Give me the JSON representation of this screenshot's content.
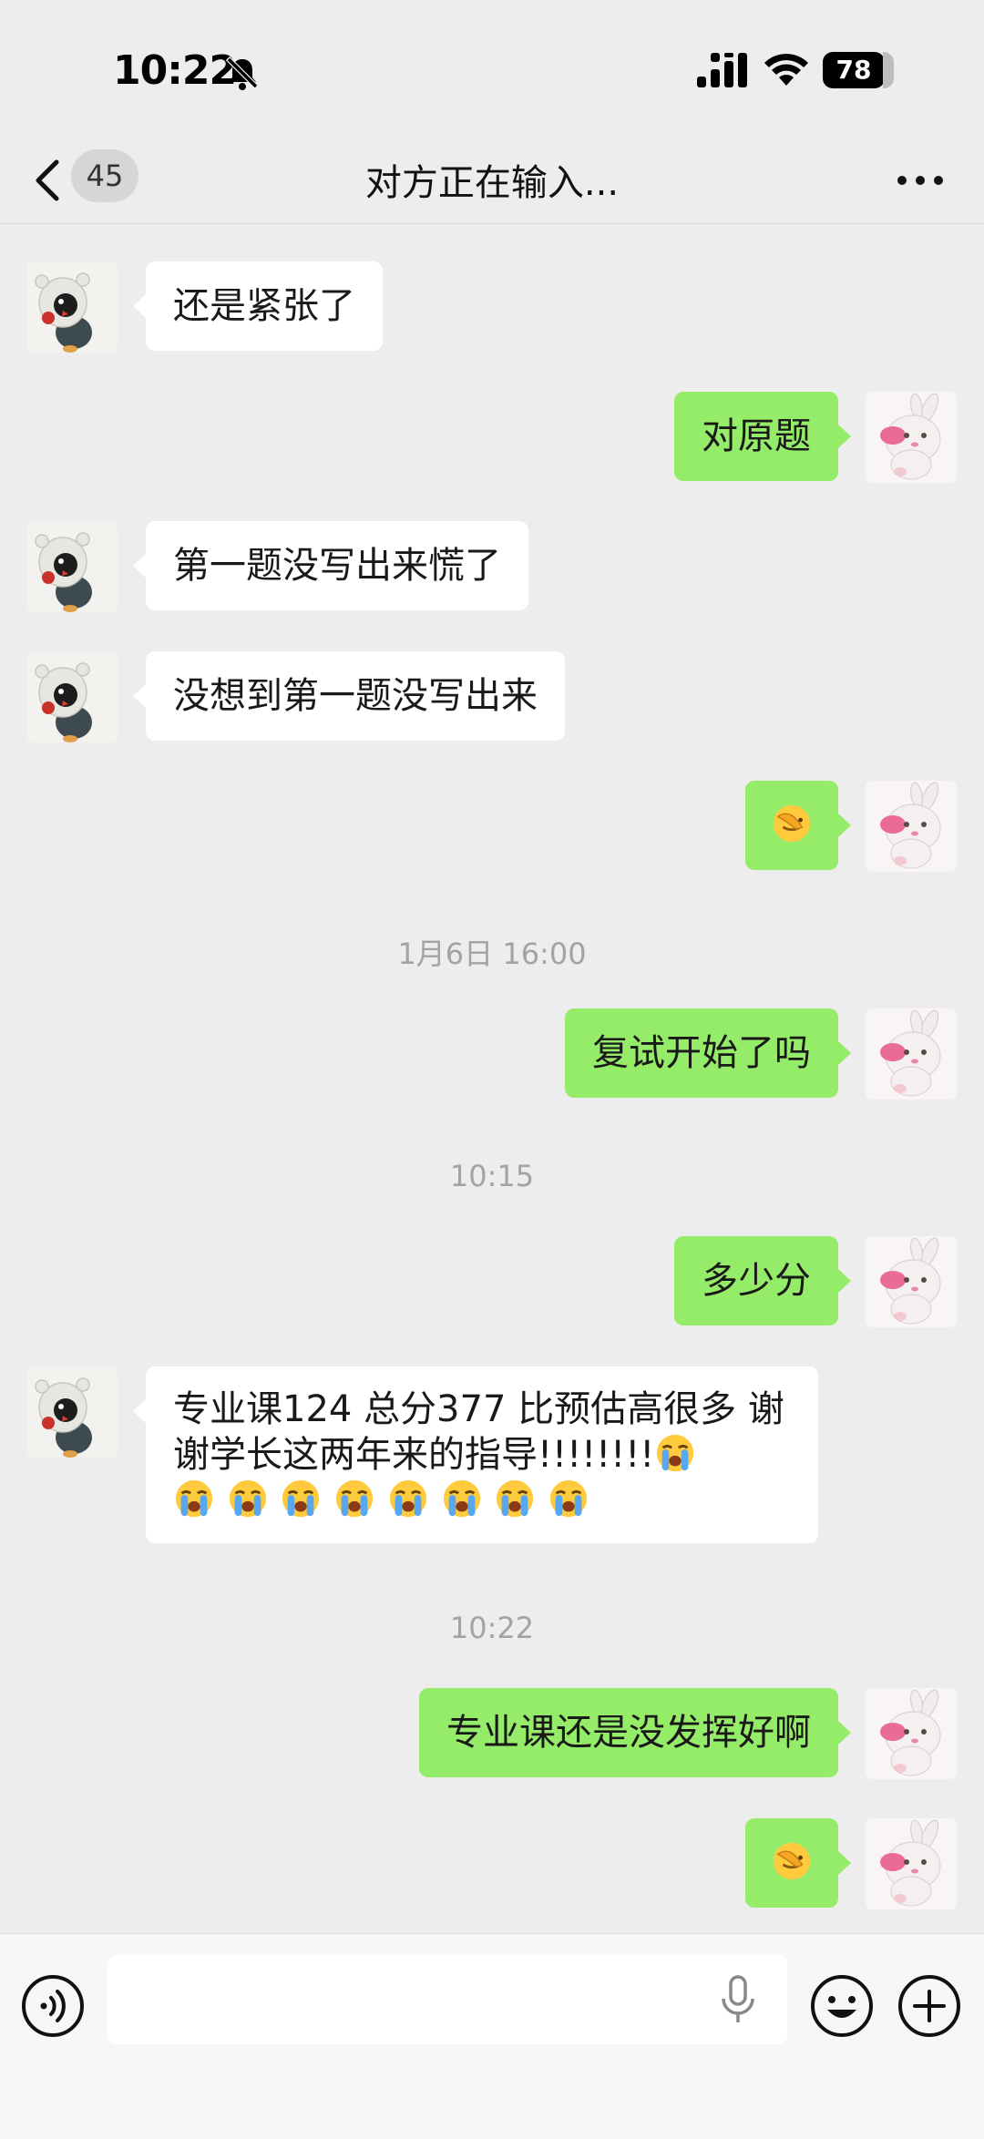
{
  "status_bar": {
    "time": "10:22",
    "battery": "78",
    "icons": [
      "bell-slash-icon",
      "signal-icon",
      "wifi-icon",
      "battery-icon"
    ]
  },
  "nav": {
    "back_icon": "chevron-left-icon",
    "unread_count": "45",
    "title": "对方正在输入...",
    "more_icon": "more-dots-icon"
  },
  "chat": {
    "messages": [
      {
        "side": "in",
        "text": "还是紧张了"
      },
      {
        "side": "out",
        "text": "对原题"
      },
      {
        "side": "in",
        "text": "第一题没写出来慌了"
      },
      {
        "side": "in",
        "text": "没想到第一题没写出来"
      },
      {
        "side": "out",
        "emoji": "face-palm-emoji"
      },
      {
        "timestamp": "1月6日 16:00"
      },
      {
        "side": "out",
        "text": "复试开始了吗"
      },
      {
        "timestamp": "10:15"
      },
      {
        "side": "out",
        "text": "多少分"
      },
      {
        "side": "in",
        "text_line1": "专业课124 总分377 比预估高很多 谢",
        "text_line2": "谢学长这两年来的指导!!!!!!!!",
        "emoji": "loudly-crying-emoji",
        "emoji_count": 9
      },
      {
        "timestamp": "10:22"
      },
      {
        "side": "out",
        "text": "专业课还是没发挥好啊"
      },
      {
        "side": "out",
        "emoji": "face-palm-emoji"
      }
    ],
    "left_avatar": "penguin-avatar",
    "right_avatar": "bunny-avatar"
  },
  "input_bar": {
    "voice_icon": "voice-icon",
    "placeholder": "",
    "mic_icon": "microphone-icon",
    "emoji_icon": "smiley-icon",
    "plus_icon": "plus-icon"
  },
  "colors": {
    "background": "#ededed",
    "outgoing_bubble": "#95ec69",
    "incoming_bubble": "#ffffff",
    "timestamp": "#a3a3a3"
  }
}
